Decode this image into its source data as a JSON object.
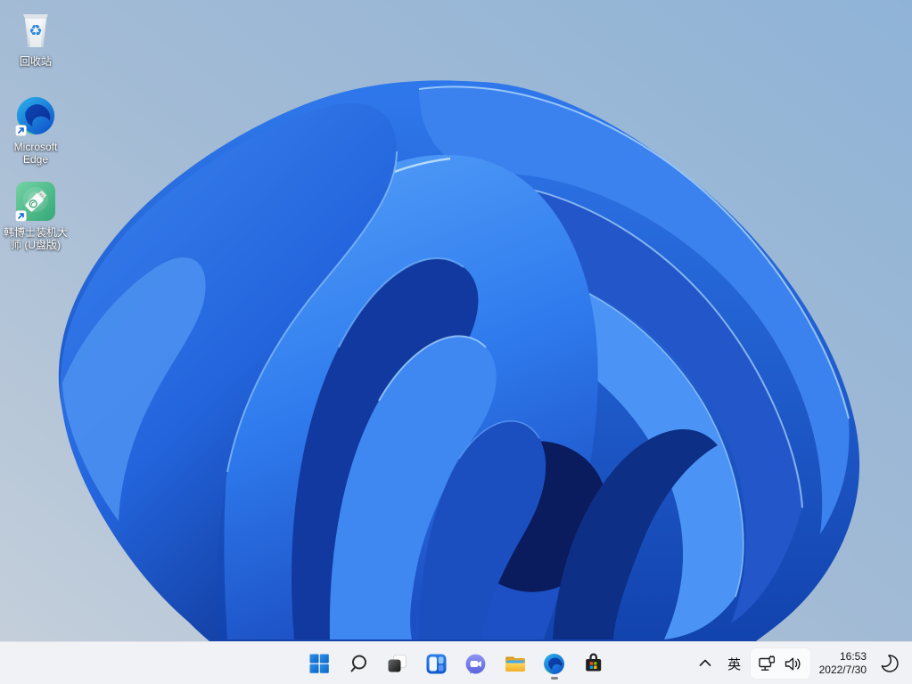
{
  "wallpaper": {
    "name": "windows-11-bloom-light",
    "bg_top": "#8fb3d7",
    "bg_bottom_left": "#c6d0db",
    "bloom_primary": "#1f5fd8",
    "bloom_dark": "#0a1c5e",
    "bloom_light_rim": "#9ccaf9"
  },
  "desktop": {
    "icons": [
      {
        "id": "recycle-bin",
        "label": "回收站",
        "icon": "recycle-bin-icon"
      },
      {
        "id": "microsoft-edge",
        "label": "Microsoft Edge",
        "icon": "edge-icon",
        "shortcut": true
      },
      {
        "id": "hanboshi-installer",
        "label": "韩博士装机大师 (U盘版)",
        "icon": "usb-installer-icon",
        "shortcut": true
      }
    ]
  },
  "taskbar": {
    "background": "#f0f2f5",
    "buttons": [
      {
        "id": "start",
        "icon": "windows-logo-icon"
      },
      {
        "id": "search",
        "icon": "magnifier-icon"
      },
      {
        "id": "task-view",
        "icon": "overlapping-squares-icon"
      },
      {
        "id": "widgets",
        "icon": "widgets-board-icon"
      },
      {
        "id": "chat",
        "icon": "video-chat-icon"
      },
      {
        "id": "file-explorer",
        "icon": "folder-icon"
      },
      {
        "id": "edge",
        "icon": "edge-swirl-icon",
        "running": true
      },
      {
        "id": "store",
        "icon": "shopping-bag-icon"
      }
    ],
    "tray": {
      "chevron": "hidden-icons",
      "ime": "英",
      "network": "ethernet-icon",
      "volume": "speaker-icon",
      "time": "16:53",
      "date": "2022/7/30",
      "focus": "moon-icon"
    }
  },
  "accent_colors": {
    "windows_blue": "#0078d4",
    "store_red": "#f25022",
    "store_green": "#7fba00",
    "store_blue": "#00a4ef",
    "store_yellow": "#ffb900"
  }
}
